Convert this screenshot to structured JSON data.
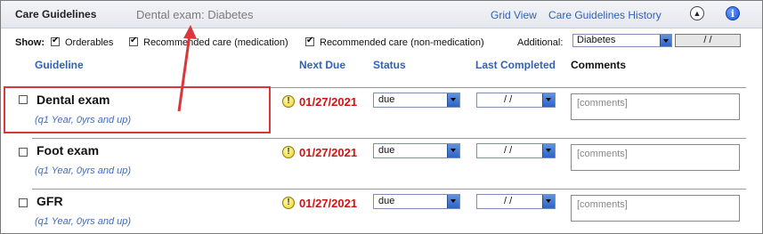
{
  "header": {
    "title": "Care Guidelines",
    "subtitle": "Dental exam: Diabetes",
    "grid_view": "Grid View",
    "history": "Care Guidelines History",
    "collapse_icon": "up-arrow-circle-icon",
    "info_icon": "info-icon"
  },
  "show": {
    "label": "Show:",
    "orderables": "Orderables",
    "rec_med": "Recommended care (medication)",
    "rec_nonmed": "Recommended care (non-medication)",
    "additional_label": "Additional:",
    "additional_value": "Diabetes",
    "date_value": "/ /"
  },
  "columns": {
    "guideline": "Guideline",
    "next_due": "Next Due",
    "status": "Status",
    "last_completed": "Last Completed",
    "comments": "Comments"
  },
  "rows": [
    {
      "name": "Dental exam",
      "freq": "(q1 Year, 0yrs and up)",
      "due": "01/27/2021",
      "status": "due",
      "last": "/ /",
      "comment_placeholder": "[comments]"
    },
    {
      "name": "Foot exam",
      "freq": "(q1 Year, 0yrs and up)",
      "due": "01/27/2021",
      "status": "due",
      "last": "/ /",
      "comment_placeholder": "[comments]"
    },
    {
      "name": "GFR",
      "freq": "(q1 Year, 0yrs and up)",
      "due": "01/27/2021",
      "status": "due",
      "last": "/ /",
      "comment_placeholder": "[comments]"
    }
  ],
  "warn_glyph": "!",
  "colors": {
    "link": "#2f62b8",
    "due": "#d41010",
    "highlight": "#d9373b"
  }
}
